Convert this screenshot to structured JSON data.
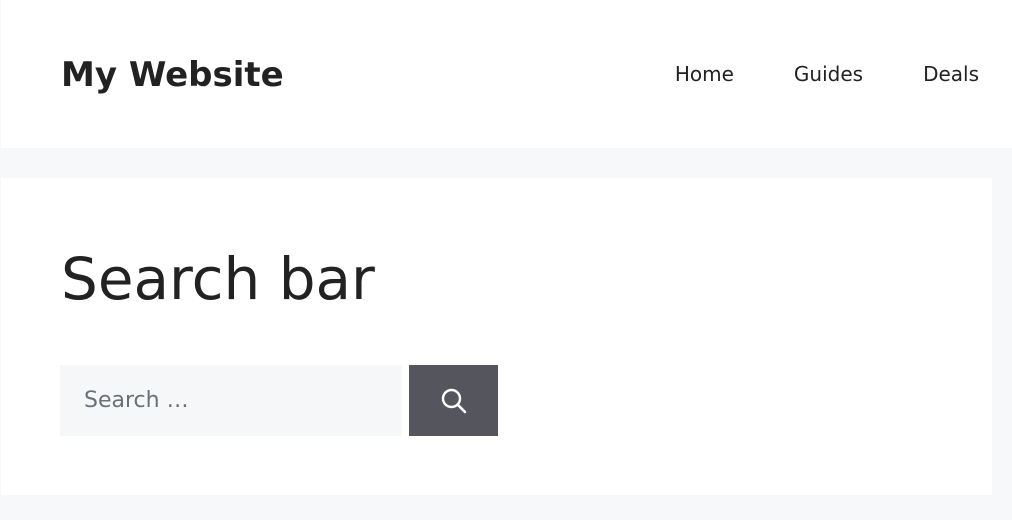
{
  "header": {
    "site_title": "My Website",
    "nav": [
      {
        "label": "Home"
      },
      {
        "label": "Guides"
      },
      {
        "label": "Deals"
      }
    ]
  },
  "main": {
    "page_title": "Search bar",
    "search": {
      "value": "",
      "placeholder": "Search …",
      "button_icon": "search-icon"
    }
  },
  "colors": {
    "page_background": "#f7f8f9",
    "card_background": "#ffffff",
    "input_background": "#f6f7f9",
    "button_background": "#55555e",
    "text": "#222222",
    "placeholder_text": "#6b6f76",
    "icon": "#ffffff"
  }
}
